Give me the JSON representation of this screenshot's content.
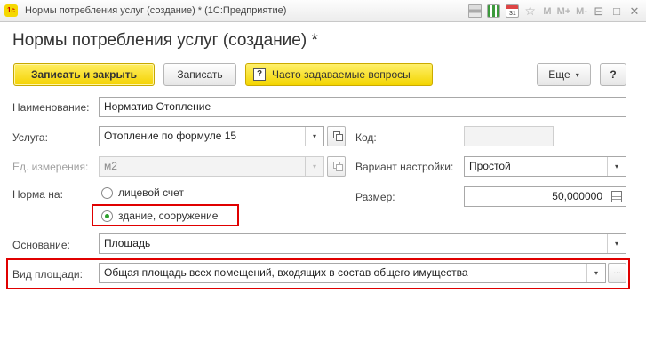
{
  "window": {
    "app_logo": "1c",
    "title": "Нормы потребления услуг (создание) * (1С:Предприятие)",
    "toolbar_icons": [
      "print-icon",
      "calculator-icon",
      "calendar-icon",
      "favorite-star-icon"
    ],
    "calendar_day": "31",
    "m_labels": [
      "M",
      "M+",
      "M-"
    ],
    "minimize": "⊟",
    "maximize": "□",
    "close": "✕"
  },
  "form": {
    "title": "Нормы потребления услуг (создание) *"
  },
  "buttons": {
    "save_close": "Записать и закрыть",
    "save": "Записать",
    "faq_icon": "?",
    "faq": "Часто задаваемые вопросы",
    "more": "Еще",
    "more_caret": "▾",
    "help": "?"
  },
  "fields": {
    "name": {
      "label": "Наименование:",
      "value": "Норматив Отопление"
    },
    "service": {
      "label": "Услуга:",
      "value": "Отопление по формуле 15"
    },
    "unit": {
      "label": "Ед. измерения:",
      "value": "м2"
    },
    "code": {
      "label": "Код:",
      "value": ""
    },
    "setup_variant": {
      "label": "Вариант настройки:",
      "value": "Простой"
    },
    "size": {
      "label": "Размер:",
      "value": "50,000000"
    },
    "norm_for": {
      "label": "Норма на:",
      "options": [
        "лицевой счет",
        "здание, сооружение"
      ],
      "selected": 1
    },
    "basis": {
      "label": "Основание:",
      "value": "Площадь"
    },
    "area_type": {
      "label": "Вид площади:",
      "value": "Общая площадь всех помещений, входящих в состав общего имущества"
    }
  },
  "glyphs": {
    "dropdown": "▾",
    "ellipsis": "..."
  },
  "colors": {
    "accent_yellow": "#f4d200",
    "highlight_red": "#e00000",
    "radio_selected": "#2ca02c"
  }
}
